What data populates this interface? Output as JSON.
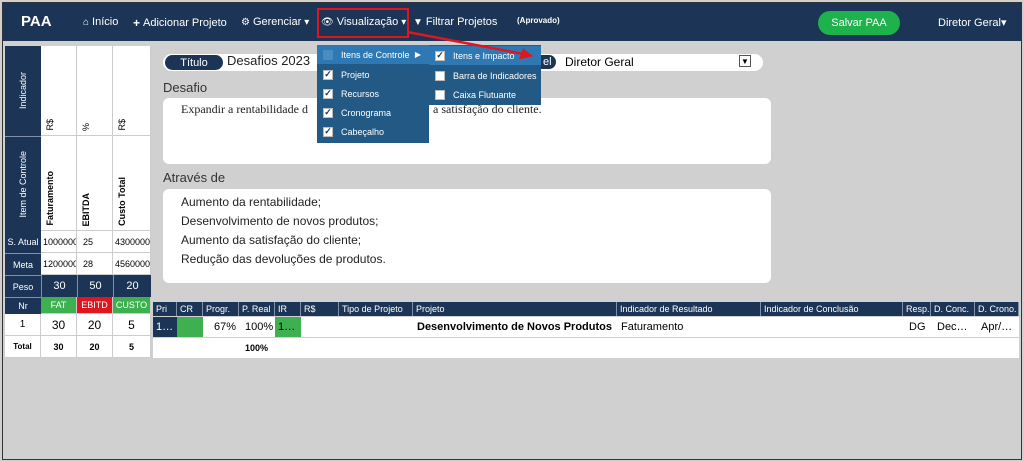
{
  "navbar": {
    "brand": "PAA",
    "inicio": "Início",
    "adicionar": "Adicionar Projeto",
    "gerenciar": "Gerenciar",
    "visualizacao": "Visualização",
    "filtrar": "Filtrar Projetos",
    "status": "(Aprovado)",
    "save": "Salvar PAA",
    "user": "Diretor Geral"
  },
  "view_menu": {
    "items": [
      {
        "label": "Itens de Controle",
        "checked": false,
        "has_submenu": true
      },
      {
        "label": "Projeto",
        "checked": true
      },
      {
        "label": "Recursos",
        "checked": true
      },
      {
        "label": "Cronograma",
        "checked": true
      },
      {
        "label": "Cabeçalho",
        "checked": true
      }
    ],
    "submenu": [
      {
        "label": "Itens e Impacto",
        "checked": true
      },
      {
        "label": "Barra de Indicadores",
        "checked": false
      },
      {
        "label": "Caixa Flutuante",
        "checked": false
      }
    ]
  },
  "left_grid": {
    "indicador_label": "Indicador",
    "item_controle_label": "Item de Controle",
    "units": [
      "R$",
      "%",
      "R$"
    ],
    "columns": [
      "Faturamento",
      "EBITDA",
      "Custo Total"
    ],
    "rows": [
      {
        "label": "S. Atual",
        "values": [
          "1000000",
          "25",
          "4300000"
        ]
      },
      {
        "label": "Meta",
        "values": [
          "1200000",
          "28",
          "4560000"
        ]
      },
      {
        "label": "Peso",
        "values": [
          "30",
          "50",
          "20"
        ]
      }
    ],
    "tags": [
      "FAT",
      "EBITD",
      "CUSTO"
    ],
    "tag_colors": [
      "#3fb04f",
      "#e0161e",
      "#3fb04f"
    ]
  },
  "form": {
    "title_label": "Título",
    "title_value": "Desafios 2023",
    "resp_label_tail": "el",
    "resp_value": "Diretor Geral",
    "desafio_label": "Desafio",
    "desafio_text_left": "Expandir a rentabilidade d",
    "desafio_text_right": "a satisfação do cliente.",
    "atraves_label": "Através de",
    "atraves_lines": [
      "Aumento da rentabilidade;",
      "Desenvolvimento de novos produtos;",
      "Aumento da satisfação do cliente;",
      "Redução das devoluções de produtos."
    ]
  },
  "table": {
    "headers": {
      "nr": "Nr",
      "pri": "Pri",
      "cr": "CR",
      "progr": "Progr.",
      "preal": "P. Real",
      "ir": "IR",
      "rs": "R$",
      "tipo": "Tipo de Projeto",
      "projeto": "Projeto",
      "ind_res": "Indicador de Resultado",
      "ind_conc": "Indicador de Conclusão",
      "resp": "Resp.",
      "dconc": "D. Conc.",
      "dcrono": "D. Crono."
    },
    "row": {
      "nr": "1",
      "v1": "30",
      "v2": "20",
      "v3": "5",
      "pri": "1…",
      "progr": "67%",
      "preal": "100%",
      "ir": "1…",
      "projeto": "Desenvolvimento de Novos Produtos",
      "ind_res": "Faturamento",
      "resp": "DG",
      "dconc": "Dec…",
      "dcrono": "Apr/…"
    },
    "total": {
      "label": "Total",
      "v1": "30",
      "v2": "20",
      "v3": "5",
      "preal": "100%"
    }
  },
  "colors": {
    "navy": "#1c3556",
    "menu": "#225a85",
    "green": "#3fb04f",
    "red": "#e0161e",
    "save": "#1db24c"
  }
}
